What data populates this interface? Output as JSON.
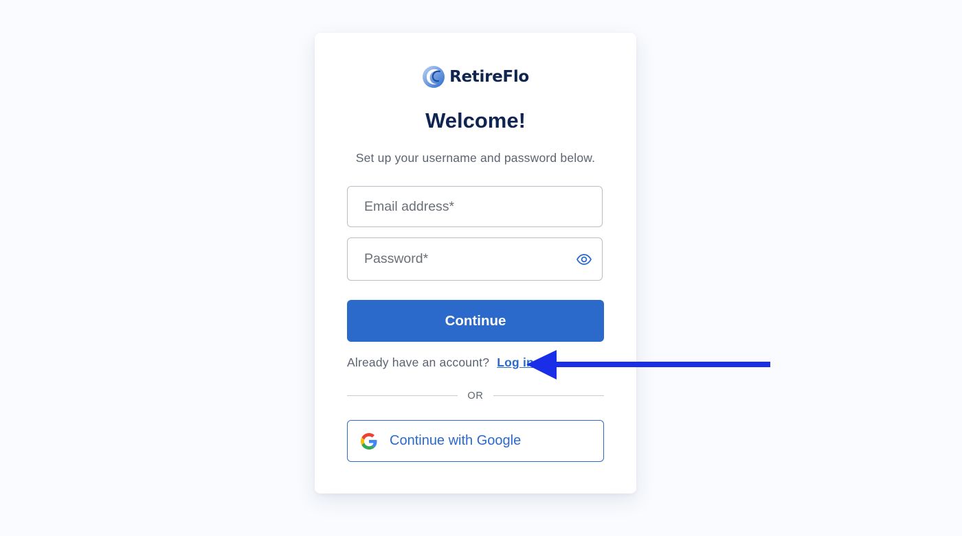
{
  "brand": {
    "name": "RetireFlo",
    "logo_icon": "wave-logo-icon"
  },
  "page": {
    "title": "Welcome!",
    "subtitle": "Set up your username and password below."
  },
  "form": {
    "email_placeholder": "Email address*",
    "email_value": "",
    "password_placeholder": "Password*",
    "password_value": "",
    "password_toggle_icon": "eye-icon",
    "continue_label": "Continue"
  },
  "login_prompt": {
    "text": "Already have an account?",
    "link_label": "Log in"
  },
  "divider_label": "OR",
  "google": {
    "label": "Continue with Google",
    "icon": "google-icon"
  },
  "annotation": {
    "icon": "arrow-left-icon",
    "color": "#1a2ee8"
  },
  "colors": {
    "primary": "#2b6acb",
    "heading": "#0f2450",
    "background": "#f9fbfe"
  }
}
